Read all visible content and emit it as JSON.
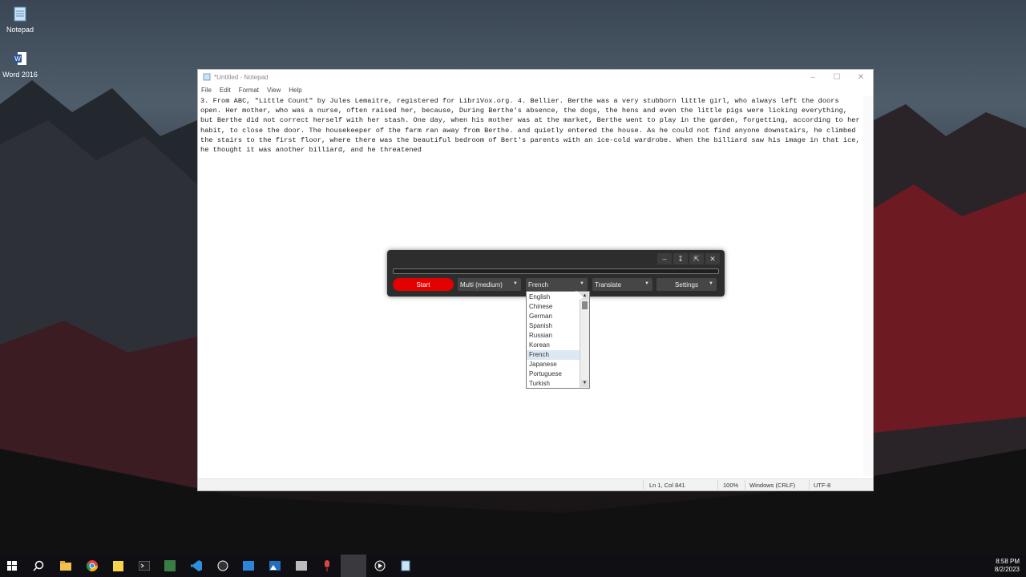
{
  "desktop": {
    "icons": [
      {
        "label": "Notepad",
        "icon": "notepad-icon"
      },
      {
        "label": "Word 2016",
        "icon": "word-icon"
      }
    ]
  },
  "notepad": {
    "title": "*Untitled - Notepad",
    "menu": [
      "File",
      "Edit",
      "Format",
      "View",
      "Help"
    ],
    "text": "3. From ABC, \"Little Count\" by Jules Lemaitre, registered for LibriVox.org. 4. Bellier. Berthe was a very stubborn little girl, who always left the doors open. Her mother, who was a nurse, often raised her, because, During Berthe's absence, the dogs, the hens and even the little pigs were licking everything, but Berthe did not correct herself with her stash. One day, when his mother was at the market, Berthe went to play in the garden, forgetting, according to her habit, to close the door. The housekeeper of the farm ran away from Berthe. and quietly entered the house. As he could not find anyone downstairs, he climbed the stairs to the first floor, where there was the beautiful bedroom of Bert's parents with an ice-cold wardrobe. When the billiard saw his image in that ice, he thought it was another billiard, and he threatened",
    "status": {
      "position": "Ln 1, Col 841",
      "zoom": "100%",
      "line_ending": "Windows (CRLF)",
      "encoding": "UTF-8"
    }
  },
  "app": {
    "start_label": "Start",
    "model": "Multi (medium)",
    "language": "French",
    "mode": "Translate",
    "settings_label": "Settings",
    "languages": [
      "English",
      "Chinese",
      "German",
      "Spanish",
      "Russian",
      "Korean",
      "French",
      "Japanese",
      "Portuguese",
      "Turkish"
    ],
    "selected_index": 6,
    "accent": "#e50000"
  },
  "taskbar": {
    "time": "8:58 PM",
    "date": "8/2/2023"
  }
}
